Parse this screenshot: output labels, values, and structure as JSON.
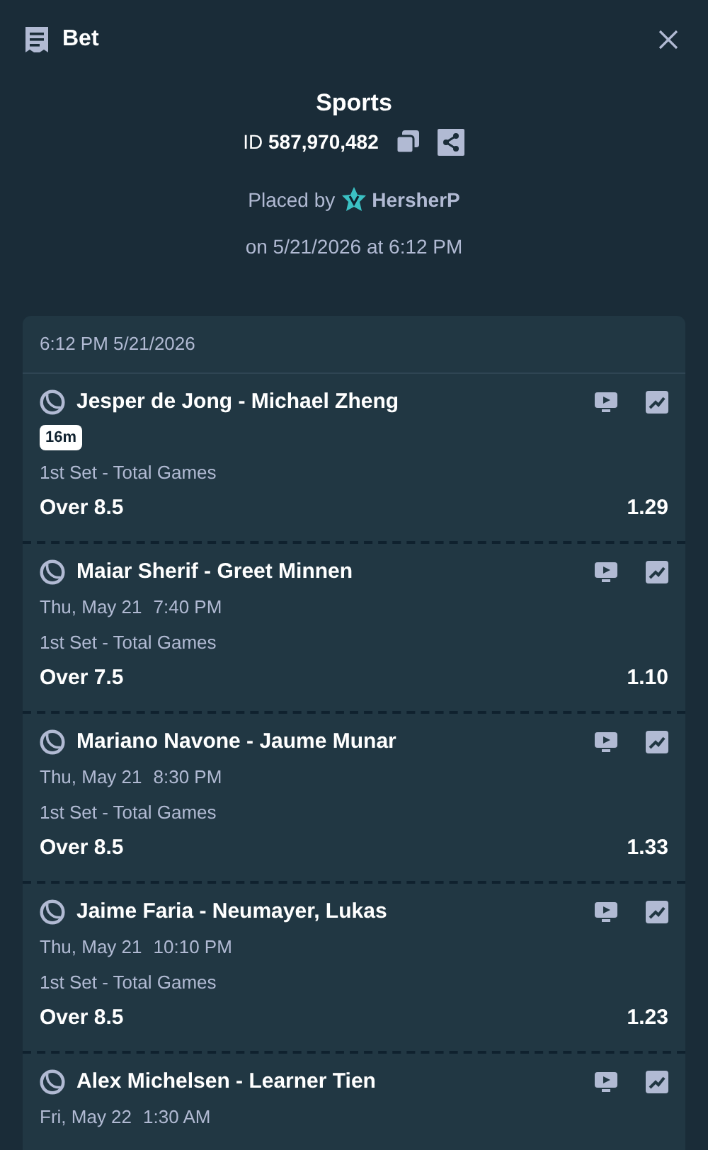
{
  "header": {
    "title": "Bet"
  },
  "summary": {
    "title": "Sports",
    "id_label": "ID",
    "id_value": "587,970,482",
    "placed_by": "Placed by",
    "user": "HersherP",
    "placed_on": "on 5/21/2026 at 6:12 PM"
  },
  "card": {
    "timestamp": "6:12 PM 5/21/2026",
    "legs": [
      {
        "kind": "live",
        "match": "Jesper de Jong - Michael Zheng",
        "badge": "16m",
        "market": "1st Set - Total Games",
        "selection": "Over 8.5",
        "odds": "1.29"
      },
      {
        "kind": "scheduled",
        "match": "Maiar Sherif - Greet Minnen",
        "date": "Thu, May 21",
        "time": "7:40 PM",
        "market": "1st Set - Total Games",
        "selection": "Over 7.5",
        "odds": "1.10"
      },
      {
        "kind": "scheduled",
        "match": "Mariano Navone - Jaume Munar",
        "date": "Thu, May 21",
        "time": "8:30 PM",
        "market": "1st Set - Total Games",
        "selection": "Over 8.5",
        "odds": "1.33"
      },
      {
        "kind": "scheduled",
        "match": "Jaime Faria - Neumayer, Lukas",
        "date": "Thu, May 21",
        "time": "10:10 PM",
        "market": "1st Set - Total Games",
        "selection": "Over 8.5",
        "odds": "1.23"
      },
      {
        "kind": "scheduled",
        "match": "Alex Michelsen - Learner Tien",
        "date": "Fri, May 22",
        "time": "1:30 AM"
      }
    ]
  }
}
